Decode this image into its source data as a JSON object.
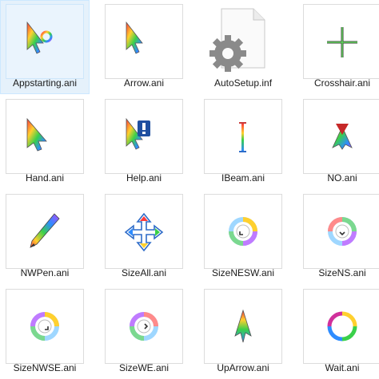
{
  "files": [
    {
      "name": "Appstarting.ani",
      "icon": "appstarting-cursor-icon",
      "selected": true
    },
    {
      "name": "Arrow.ani",
      "icon": "arrow-cursor-icon"
    },
    {
      "name": "AutoSetup.inf",
      "icon": "settings-file-icon"
    },
    {
      "name": "Crosshair.ani",
      "icon": "crosshair-cursor-icon"
    },
    {
      "name": "Hand.ani",
      "icon": "hand-cursor-icon"
    },
    {
      "name": "Help.ani",
      "icon": "help-cursor-icon"
    },
    {
      "name": "IBeam.ani",
      "icon": "ibeam-cursor-icon"
    },
    {
      "name": "NO.ani",
      "icon": "no-cursor-icon"
    },
    {
      "name": "NWPen.ani",
      "icon": "pen-cursor-icon"
    },
    {
      "name": "SizeAll.ani",
      "icon": "sizeall-cursor-icon"
    },
    {
      "name": "SizeNESW.ani",
      "icon": "sizenesw-cursor-icon"
    },
    {
      "name": "SizeNS.ani",
      "icon": "sizens-cursor-icon"
    },
    {
      "name": "SizeNWSE.ani",
      "icon": "sizenwse-cursor-icon"
    },
    {
      "name": "SizeWE.ani",
      "icon": "sizewe-cursor-icon"
    },
    {
      "name": "UpArrow.ani",
      "icon": "uparrow-cursor-icon"
    },
    {
      "name": "Wait.ani",
      "icon": "wait-cursor-icon"
    }
  ],
  "colors": {
    "selection_bg": "#e5f1fb",
    "selection_border": "#cce8ff",
    "thumb_border": "#dcdcdc"
  }
}
